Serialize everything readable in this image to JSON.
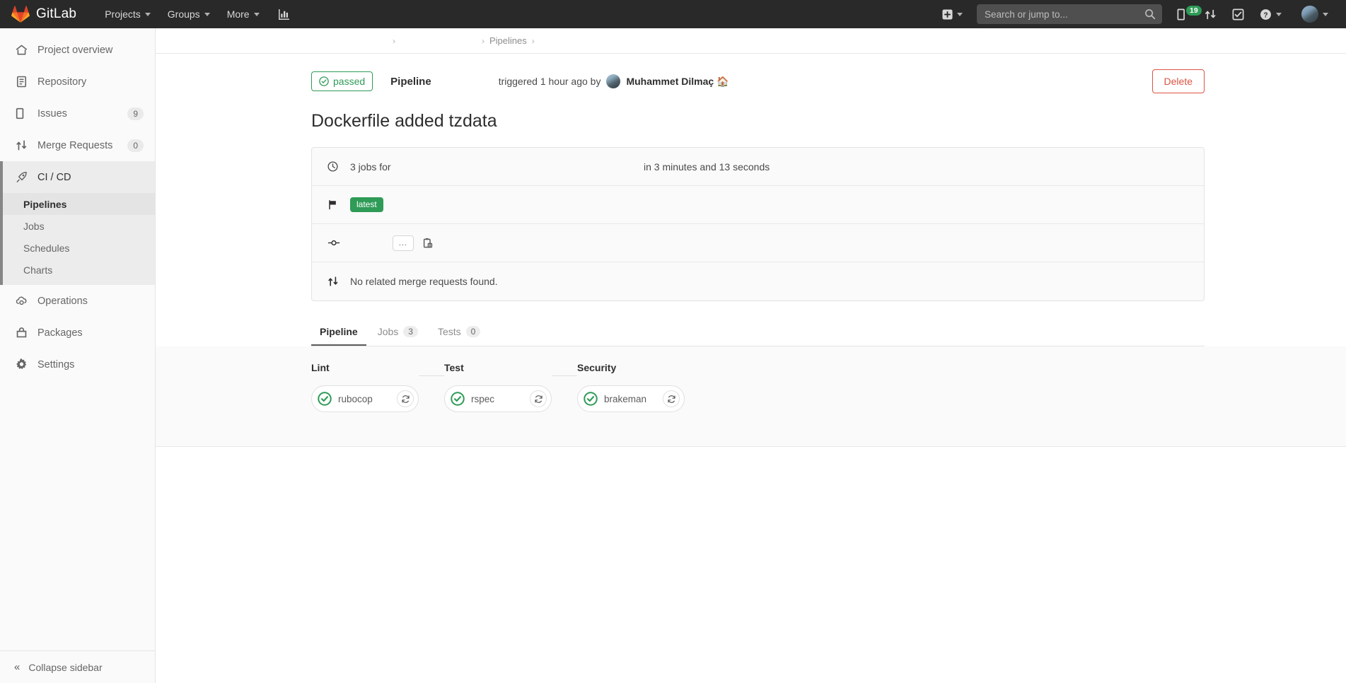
{
  "navbar": {
    "brand": "GitLab",
    "items": [
      {
        "label": "Projects",
        "name": "nav-projects"
      },
      {
        "label": "Groups",
        "name": "nav-groups"
      },
      {
        "label": "More",
        "name": "nav-more"
      }
    ],
    "analytics_icon": "chart-bar-icon",
    "plus_icon": "plus-square-icon",
    "search": {
      "placeholder": "Search or jump to...",
      "value": "",
      "icon": "search-icon"
    },
    "issues_icon": "issues-icon",
    "issues_count": "19",
    "merge_requests_icon": "merge-request-icon",
    "todos_icon": "todo-check-icon",
    "help_icon": "question-circle-icon",
    "avatar_icon": "user-avatar"
  },
  "sidebar": {
    "items": [
      {
        "label": "Project overview",
        "icon": "home-icon",
        "count": ""
      },
      {
        "label": "Repository",
        "icon": "document-icon",
        "count": ""
      },
      {
        "label": "Issues",
        "icon": "issues-icon",
        "count": "9"
      },
      {
        "label": "Merge Requests",
        "icon": "merge-request-icon",
        "count": "0"
      },
      {
        "label": "CI / CD",
        "icon": "rocket-icon",
        "count": ""
      },
      {
        "label": "Operations",
        "icon": "cloud-gear-icon",
        "count": ""
      },
      {
        "label": "Packages",
        "icon": "package-icon",
        "count": ""
      },
      {
        "label": "Settings",
        "icon": "gear-icon",
        "count": ""
      }
    ],
    "cicd_sub_items": [
      {
        "label": "Pipelines",
        "selected": true
      },
      {
        "label": "Jobs",
        "selected": false
      },
      {
        "label": "Schedules",
        "selected": false
      },
      {
        "label": "Charts",
        "selected": false
      }
    ],
    "collapse_label": "Collapse sidebar",
    "collapse_icon": "double-chevron-left-icon"
  },
  "breadcrumb": {
    "items": [
      "",
      "",
      "Pipelines",
      ""
    ]
  },
  "pipeline_header": {
    "status_label": "passed",
    "status_icon": "check-circle-icon",
    "status_color": "#2e9b57",
    "entity_label": "Pipeline",
    "triggered_text": "triggered 1 hour ago by",
    "user_name": "Muhammet Dilmaç 🏠",
    "delete_label": "Delete",
    "delete_color": "#dd5442"
  },
  "commit": {
    "title": "Dockerfile added tzdata"
  },
  "info_card": {
    "jobs_row": {
      "icon": "clock-icon",
      "jobs_text": "3 jobs for",
      "duration_text": "in 3 minutes and 13 seconds"
    },
    "tag_row": {
      "icon": "flag-icon",
      "tag_label": "latest",
      "tag_color": "#2e9b57"
    },
    "commit_row": {
      "icon": "commit-icon",
      "ellipsis_label": "...",
      "clipboard_icon": "clipboard-icon"
    },
    "mr_row": {
      "icon": "merge-request-icon",
      "text": "No related merge requests found."
    }
  },
  "tabs": [
    {
      "label": "Pipeline",
      "count": "",
      "active": true
    },
    {
      "label": "Jobs",
      "count": "3",
      "active": false
    },
    {
      "label": "Tests",
      "count": "0",
      "active": false
    }
  ],
  "graph": {
    "stages": [
      {
        "name": "Lint",
        "job": "rubocop",
        "status": "success",
        "retry_icon": "retry-icon"
      },
      {
        "name": "Test",
        "job": "rspec",
        "status": "success",
        "retry_icon": "retry-icon"
      },
      {
        "name": "Security",
        "job": "brakeman",
        "status": "success",
        "retry_icon": "retry-icon"
      }
    ],
    "success_color": "#2e9b57"
  }
}
